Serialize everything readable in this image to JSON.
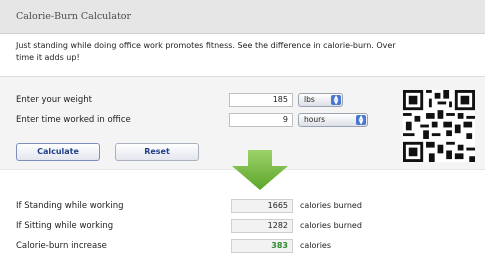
{
  "app": {
    "title": "Calorie-Burn Calculator"
  },
  "intro": {
    "line1": "Just standing while doing office work promotes fitness. See the difference in calorie-burn. Over",
    "line2": "time it adds up!"
  },
  "form": {
    "weight_label": "Enter your weight",
    "weight_value": "185",
    "weight_unit": "lbs",
    "hours_label": "Enter time worked in office",
    "hours_value": "9",
    "hours_unit": "hours"
  },
  "buttons": {
    "calculate": "Calculate",
    "reset": "Reset"
  },
  "results": {
    "standing_label": "If Standing while working",
    "standing_value": "1665",
    "standing_unit": "calories burned",
    "sitting_label": "If Sitting while working",
    "sitting_value": "1282",
    "sitting_unit": "calories burned",
    "increase_label": "Calorie-burn increase",
    "increase_value": "383",
    "increase_unit": "calories"
  },
  "colors": {
    "accent_green": "#6cb33e",
    "button_text": "#1f3f88"
  },
  "icons": {
    "arrow": "down-arrow-icon",
    "qr": "qr-code-icon",
    "dropdown": "select-arrows-icon"
  }
}
